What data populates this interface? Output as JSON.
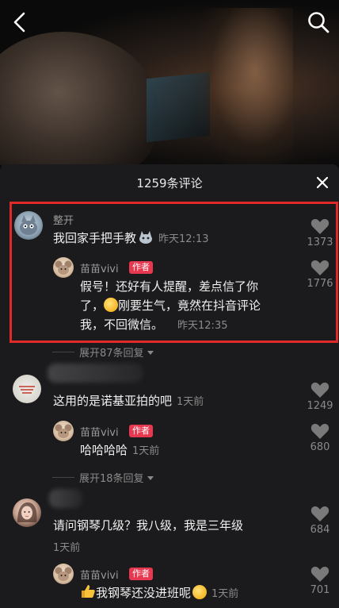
{
  "header": {
    "comment_count": "1259条评论"
  },
  "comments": [
    {
      "username": "整开",
      "text": "我回家手把手教",
      "time": "昨天12:13",
      "likes": "1373",
      "reply": {
        "username": "苗苗vivi",
        "author_tag": "作者",
        "text_line1": "假号！还好有人提醒，差点信了你",
        "text_line2_a": "了，",
        "text_line2_b": "刚要生气，竟然在抖音评论",
        "text_line3": "我，不回微信。",
        "time": "昨天12:35",
        "likes": "1776"
      },
      "expand_label": "展开87条回复"
    },
    {
      "username": "",
      "text": "这用的是诺基亚拍的吧",
      "time": "1天前",
      "likes": "1249",
      "reply": {
        "username": "苗苗vivi",
        "author_tag": "作者",
        "text": "哈哈哈哈",
        "time": "1天前",
        "likes": "680"
      },
      "expand_label": "展开18条回复"
    },
    {
      "username": "",
      "text": "请问钢琴几级？我八级，我是三年级",
      "time": "1天前",
      "likes": "684",
      "reply": {
        "username": "苗苗vivi",
        "author_tag": "作者",
        "text": "我钢琴还没进班呢",
        "time": "1天前",
        "likes": "701"
      }
    }
  ],
  "colors": {
    "panel_bg": "#1b1b1d",
    "author_tag": "#e8384f",
    "highlight_border": "#e02a2a"
  }
}
